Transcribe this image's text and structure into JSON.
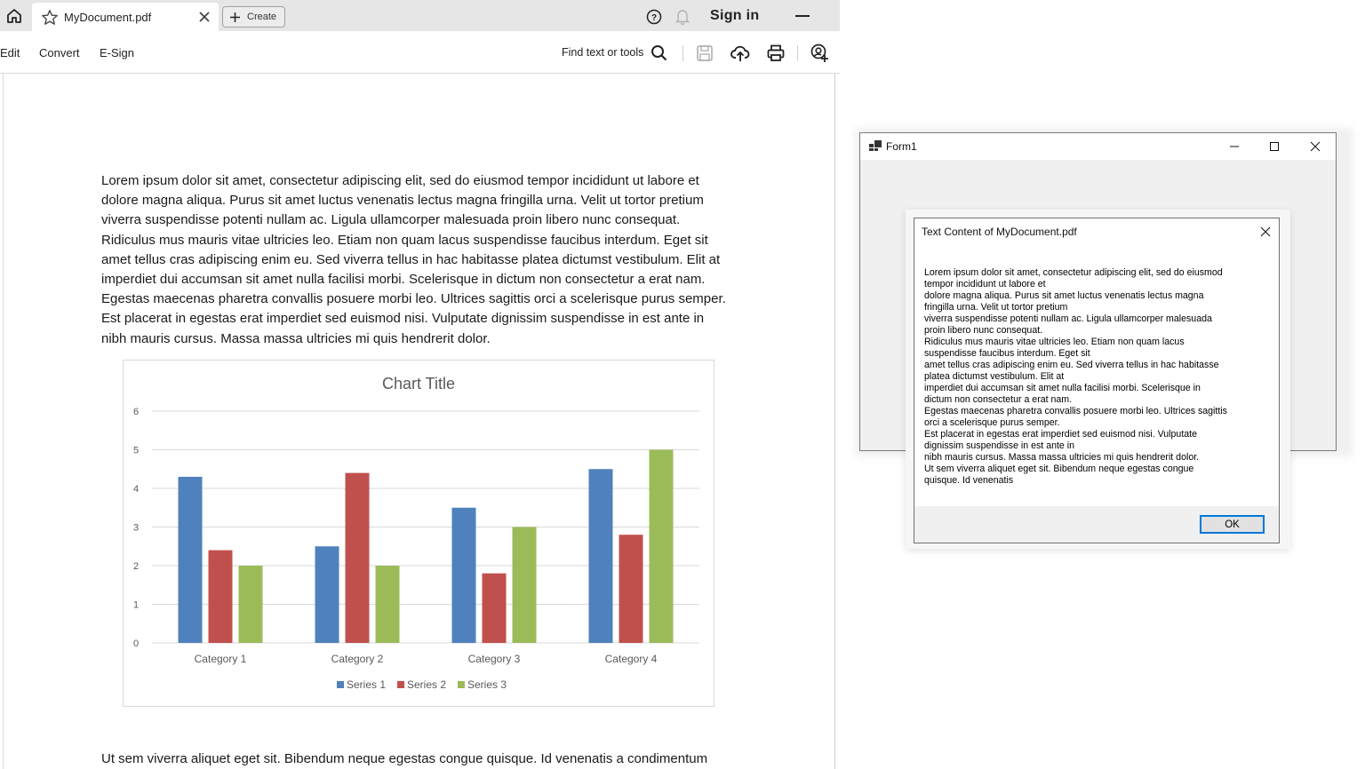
{
  "acrobat": {
    "tab_title": "MyDocument.pdf",
    "create_label": "Create",
    "signin_label": "Sign in",
    "menu": [
      "Edit",
      "Convert",
      "E-Sign"
    ],
    "find_label": "Find text or tools",
    "icons": {
      "home": "home-icon",
      "star": "star-icon",
      "close": "close-icon",
      "plus": "plus-icon",
      "help": "help-icon",
      "bell": "bell-icon",
      "minimize": "minimize-icon",
      "search": "search-icon",
      "save": "save-icon",
      "upload": "cloud-upload-icon",
      "print": "print-icon",
      "share": "add-user-icon"
    }
  },
  "document": {
    "paragraph1_lines": [
      "Lorem ipsum dolor sit amet, consectetur adipiscing elit, sed do eiusmod tempor incididunt ut labore et",
      "dolore magna aliqua. Purus sit amet luctus venenatis lectus magna fringilla urna. Velit ut tortor pretium",
      "viverra suspendisse potenti nullam ac. Ligula ullamcorper malesuada proin libero nunc consequat.",
      "Ridiculus mus mauris vitae ultricies leo. Etiam non quam lacus suspendisse faucibus interdum. Eget sit",
      "amet tellus cras adipiscing enim eu. Sed viverra tellus in hac habitasse platea dictumst vestibulum. Elit at",
      "imperdiet dui accumsan sit amet nulla facilisi morbi. Scelerisque in dictum non consectetur a erat nam.",
      "Egestas maecenas pharetra convallis posuere morbi leo. Ultrices sagittis orci a scelerisque purus semper.",
      "Est placerat in egestas erat imperdiet sed euismod nisi. Vulputate dignissim suspendisse in est ante in",
      "nibh mauris cursus. Massa massa ultricies mi quis hendrerit dolor."
    ],
    "paragraph2": "Ut sem viverra aliquet eget sit. Bibendum neque egestas congue quisque. Id venenatis a condimentum"
  },
  "chart_data": {
    "type": "bar",
    "title": "Chart Title",
    "categories": [
      "Category 1",
      "Category 2",
      "Category 3",
      "Category 4"
    ],
    "series": [
      {
        "name": "Series 1",
        "color": "#4f81bd",
        "values": [
          4.3,
          2.5,
          3.5,
          4.5
        ]
      },
      {
        "name": "Series 2",
        "color": "#c0504d",
        "values": [
          2.4,
          4.4,
          1.8,
          2.8
        ]
      },
      {
        "name": "Series 3",
        "color": "#9bbb59",
        "values": [
          2,
          2,
          3,
          5
        ]
      }
    ],
    "xlabel": "",
    "ylabel": "",
    "ylim": [
      0,
      6
    ],
    "yticks": [
      0,
      1,
      2,
      3,
      4,
      5,
      6
    ],
    "grid": true,
    "legend": "bottom"
  },
  "form1": {
    "title": "Form1",
    "icons": {
      "app": "form-app-icon",
      "minimize": "minimize-icon",
      "maximize": "maximize-icon",
      "close": "close-icon"
    }
  },
  "messagebox": {
    "title": "Text Content of MyDocument.pdf",
    "lines": [
      "Lorem ipsum dolor sit amet, consectetur adipiscing elit, sed do eiusmod",
      "tempor incididunt ut labore et",
      "dolore magna aliqua. Purus sit amet luctus venenatis lectus magna",
      "fringilla urna. Velit ut tortor pretium",
      "viverra suspendisse potenti nullam ac. Ligula ullamcorper malesuada",
      "proin libero nunc consequat.",
      "Ridiculus mus mauris vitae ultricies leo. Etiam non quam lacus",
      "suspendisse faucibus interdum. Eget sit",
      "amet tellus cras adipiscing enim eu. Sed viverra tellus in hac habitasse",
      "platea dictumst vestibulum. Elit at",
      "imperdiet dui accumsan sit amet nulla facilisi morbi. Scelerisque in",
      "dictum non consectetur a erat nam.",
      "Egestas maecenas pharetra convallis posuere morbi leo. Ultrices sagittis",
      "orci a scelerisque purus semper.",
      "Est placerat in egestas erat imperdiet sed euismod nisi. Vulputate",
      "dignissim suspendisse in est ante in",
      "nibh mauris cursus. Massa massa ultricies mi quis hendrerit dolor.",
      "Ut sem viverra aliquet eget sit. Bibendum neque egestas congue",
      "quisque. Id venenatis"
    ],
    "ok_label": "OK"
  }
}
